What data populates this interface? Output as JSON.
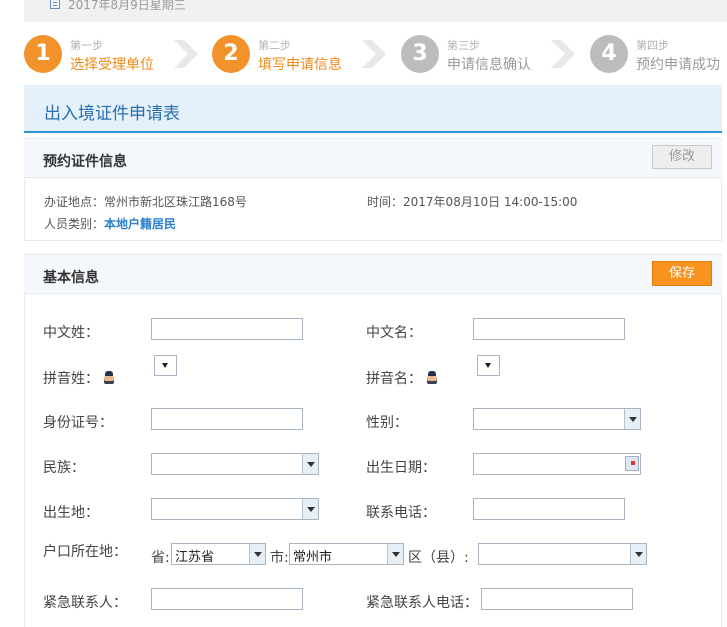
{
  "header": {
    "date_text": "2017年8月9日星期三"
  },
  "steps": [
    {
      "num": "1",
      "small": "第一步",
      "big": "选择受理单位"
    },
    {
      "num": "2",
      "small": "第二步",
      "big": "填写申请信息"
    },
    {
      "num": "3",
      "small": "第三步",
      "big": "申请信息确认"
    },
    {
      "num": "4",
      "small": "第四步",
      "big": "预约申请成功"
    }
  ],
  "form_title": "出入境证件申请表",
  "reservation": {
    "heading": "预约证件信息",
    "edit_label": "修改",
    "location_label": "办证地点：",
    "location_value": "常州市新北区珠江路168号",
    "time_label": "时间：",
    "time_value": "2017年08月10日 14:00-15:00",
    "category_label": "人员类别：",
    "category_value": "本地户籍居民"
  },
  "basic": {
    "heading": "基本信息",
    "save_label": "保存",
    "fields": {
      "surname": {
        "label": "中文姓：",
        "value": ""
      },
      "given_name": {
        "label": "中文名：",
        "value": ""
      },
      "pinyin_surname": {
        "label": "拼音姓："
      },
      "pinyin_given": {
        "label": "拼音名："
      },
      "id_number": {
        "label": "身份证号：",
        "value": ""
      },
      "gender": {
        "label": "性别：",
        "value": ""
      },
      "ethnicity": {
        "label": "民族：",
        "value": ""
      },
      "birth_date": {
        "label": "出生日期：",
        "value": ""
      },
      "birthplace": {
        "label": "出生地：",
        "value": ""
      },
      "phone": {
        "label": "联系电话：",
        "value": ""
      },
      "hukou": {
        "label": "户口所在地：",
        "province_label": "省:",
        "province_value": "江苏省",
        "city_label": "市:",
        "city_value": "常州市",
        "district_label": "区（县）:",
        "district_value": ""
      },
      "emergency_contact": {
        "label": "紧急联系人：",
        "value": ""
      },
      "emergency_phone": {
        "label": "紧急联系人电话：",
        "value": ""
      }
    }
  },
  "colors": {
    "accent_orange": "#f2922a",
    "accent_blue": "#2d95d6",
    "title_blue": "#2a6fb0",
    "inactive_gray": "#bcbcbc"
  }
}
